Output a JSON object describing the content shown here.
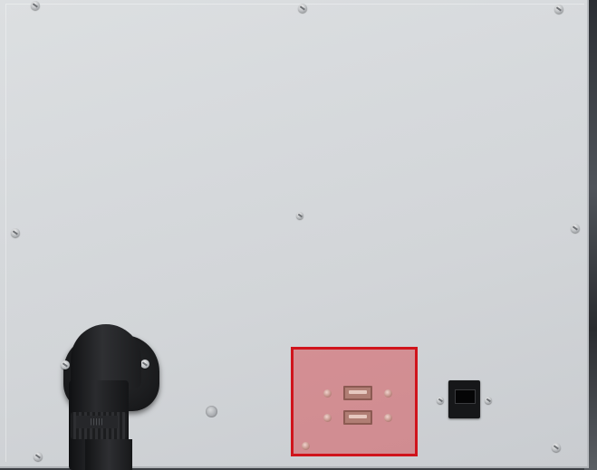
{
  "scene": {
    "description_label": "",
    "panel_color": "#d6d9dc",
    "highlight_color": "#d0141c",
    "connector_label": "|||||"
  }
}
